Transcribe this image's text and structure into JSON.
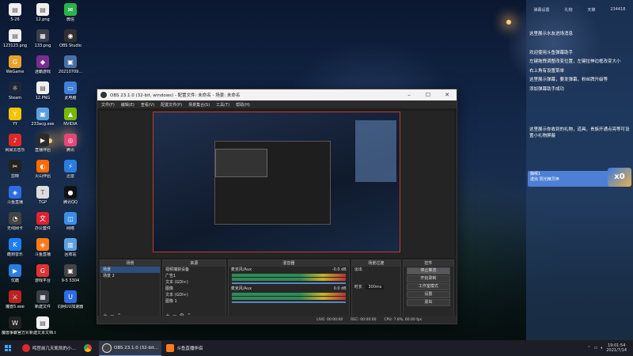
{
  "desktop": {
    "icons": [
      {
        "label": "5-26",
        "color": "#f0f0f0",
        "glyph": "▤"
      },
      {
        "label": "12.png",
        "color": "#f0f0f0",
        "glyph": "▤"
      },
      {
        "label": "微信",
        "color": "#2bb24c",
        "glyph": "✉"
      },
      {
        "label": "123123.png",
        "color": "#f0f0f0",
        "glyph": "▤"
      },
      {
        "label": "133.png",
        "color": "#3a3f4a",
        "glyph": "▦"
      },
      {
        "label": "OBS Studio",
        "color": "#303030",
        "glyph": "◉"
      },
      {
        "label": "WeGame",
        "color": "#e8a32b",
        "glyph": "G"
      },
      {
        "label": "迷霸游戏",
        "color": "#7b2d8e",
        "glyph": "◆"
      },
      {
        "label": "20210709...",
        "color": "#4a6fa5",
        "glyph": "▣"
      },
      {
        "label": "Steam",
        "color": "#1b2838",
        "glyph": "☼"
      },
      {
        "label": "12.PNG",
        "color": "#f0f0f0",
        "glyph": "▤"
      },
      {
        "label": "此电脑",
        "color": "#3d7fd9",
        "glyph": "▭"
      },
      {
        "label": "YY",
        "color": "#f5c400",
        "glyph": "Y"
      },
      {
        "label": "233acg.exe",
        "color": "#5aa0e0",
        "glyph": "▣"
      },
      {
        "label": "NVIDIA",
        "color": "#76b900",
        "glyph": "▲"
      },
      {
        "label": "网易云音乐",
        "color": "#e02828",
        "glyph": "♪"
      },
      {
        "label": "直播伴侣",
        "color": "#2b2b2b",
        "glyph": "▶"
      },
      {
        "label": "腾讯",
        "color": "#e6457a",
        "glyph": "◎"
      },
      {
        "label": "剪映",
        "color": "#222",
        "glyph": "✂"
      },
      {
        "label": "火山伴侣",
        "color": "#ff6a00",
        "glyph": "◐"
      },
      {
        "label": "迅雷",
        "color": "#2a7de1",
        "glyph": "⚡"
      },
      {
        "label": "斗鱼直播",
        "color": "#2b6de3",
        "glyph": "◈"
      },
      {
        "label": "TGP",
        "color": "#ddd",
        "glyph": "T"
      },
      {
        "label": "腾讯QQ",
        "color": "#111",
        "glyph": "●"
      },
      {
        "label": "无线网卡",
        "color": "#444",
        "glyph": "◔"
      },
      {
        "label": "办公套件",
        "color": "#d23",
        "glyph": "文"
      },
      {
        "label": "网络",
        "color": "#3a8ee6",
        "glyph": "◫"
      },
      {
        "label": "酷狗音乐",
        "color": "#1c7ef2",
        "glyph": "K"
      },
      {
        "label": "斗鱼直播",
        "color": "#ff7a1a",
        "glyph": "◈"
      },
      {
        "label": "回收站",
        "color": "#5aa0e0",
        "glyph": "▥"
      },
      {
        "label": "优酷",
        "color": "#2a7de1",
        "glyph": "▶"
      },
      {
        "label": "游戏平台",
        "color": "#d33",
        "glyph": "G"
      },
      {
        "label": "9-5 5304",
        "color": "#444",
        "glyph": "▣"
      },
      {
        "label": "魔兽5.exe",
        "color": "#b22",
        "glyph": "⚔"
      },
      {
        "label": "新建文件",
        "color": "#3a3f4a",
        "glyph": "▦"
      },
      {
        "label": "同网UU加速器",
        "color": "#2b6de3",
        "glyph": "U"
      },
      {
        "label": "魔兽争霸官方对战平台",
        "color": "#222",
        "glyph": "W"
      },
      {
        "label": "新建文本文档.txt",
        "color": "#f0f0f0",
        "glyph": "▤"
      }
    ]
  },
  "obs": {
    "title": "OBS 23.1.0 (32-bit, windows) - 配置文件: 未命名 - 场景: 未命名",
    "menu": [
      "文件(F)",
      "编辑(E)",
      "查看(V)",
      "配置文件(P)",
      "场景集合(S)",
      "工具(T)",
      "帮助(H)"
    ],
    "docks": {
      "scenes": {
        "title": "场景",
        "items": [
          "场景",
          "场景 2"
        ]
      },
      "sources": {
        "title": "来源",
        "items": [
          "视频捕获设备",
          "广告1",
          "文本 (GDI+)",
          "图像",
          "文本 (GDI+)",
          "图像 1"
        ]
      },
      "mixer": {
        "title": "混音器",
        "channels": [
          {
            "name": "麦克风/Aux",
            "db": "-0.0 dB"
          },
          {
            "name": "麦克风/Aux",
            "db": "0.0 dB"
          }
        ]
      },
      "transitions": {
        "title": "场景过渡",
        "type": "淡出",
        "duration_label": "时长",
        "duration": "300ms"
      },
      "controls": {
        "title": "控件",
        "buttons": [
          "停止推流",
          "开始录制",
          "工作室模式",
          "设置",
          "退出"
        ]
      }
    },
    "status": {
      "live": "LIVE: 00:00:00",
      "rec": "REC: 00:00:00",
      "cpu": "CPU: 7.8%, 60.00 fps"
    }
  },
  "panel": {
    "tabs": [
      "弹幕设置",
      "礼物",
      "天梯",
      "234418"
    ],
    "header": "这里展示水友进场消息",
    "welcome": "欢迎使用斗鱼弹幕助手",
    "lines": [
      "左键拖拽调整改变位置，左键拉伸边框改变大小",
      "右上角有设置菜单",
      "这里展示弹幕，要发弹幕，粉丝牌升级等",
      "添加弹幕助手成功"
    ],
    "gift_hint": "这里展示你收到的礼物，道具，贵族开通点亮等可设置小礼物屏蔽",
    "card": [
      "静候1",
      "送出",
      "阳光精灵神"
    ],
    "badge": "x0"
  },
  "taskbar": {
    "tasks": [
      "鸣哲前几天凯凯的小…",
      "OBS 23.1.0 (32-bit…",
      "斗鱼直播伴侣"
    ],
    "time": "19:01:54",
    "date": "2021/7/14"
  }
}
